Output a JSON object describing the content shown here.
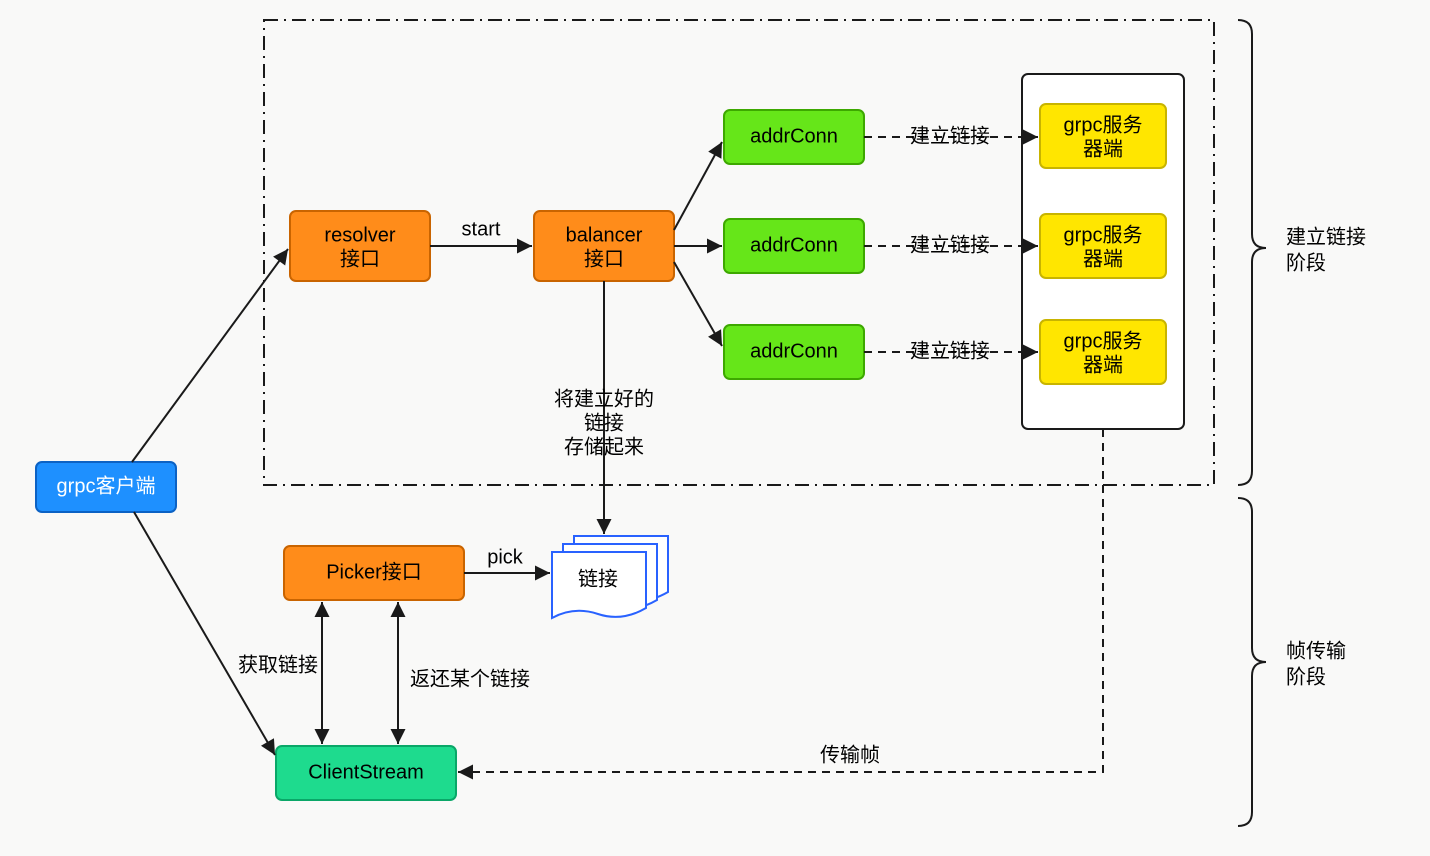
{
  "nodes": {
    "client": {
      "label": "grpc客户端"
    },
    "resolver": {
      "line1": "resolver",
      "line2": "接口"
    },
    "balancer": {
      "line1": "balancer",
      "line2": "接口"
    },
    "addrConn1": {
      "label": "addrConn"
    },
    "addrConn2": {
      "label": "addrConn"
    },
    "addrConn3": {
      "label": "addrConn"
    },
    "server1": {
      "line1": "grpc服务",
      "line2": "器端"
    },
    "server2": {
      "line1": "grpc服务",
      "line2": "器端"
    },
    "server3": {
      "line1": "grpc服务",
      "line2": "器端"
    },
    "picker": {
      "label": "Picker接口"
    },
    "links": {
      "label": "链接"
    },
    "clientStream": {
      "label": "ClientStream"
    }
  },
  "edges": {
    "start": {
      "label": "start"
    },
    "conn1": {
      "label": "建立链接"
    },
    "conn2": {
      "label": "建立链接"
    },
    "conn3": {
      "label": "建立链接"
    },
    "store": {
      "line1": "将建立好的",
      "line2": "链接",
      "line3": "存储起来"
    },
    "pick": {
      "label": "pick"
    },
    "getConn": {
      "label": "获取链接"
    },
    "returnConn": {
      "label": "返还某个链接"
    },
    "transmit": {
      "label": "传输帧"
    }
  },
  "phases": {
    "phase1": {
      "line1": "建立链接",
      "line2": "阶段"
    },
    "phase2": {
      "line1": "帧传输",
      "line2": "阶段"
    }
  },
  "colors": {
    "blue": "#1e90ff",
    "orange": "#ff8c1a",
    "green": "#66e619",
    "yellow": "#ffe600",
    "teal": "#1edb8e",
    "stroke": "#1a1a1a",
    "linkBlue": "#2962ff"
  }
}
